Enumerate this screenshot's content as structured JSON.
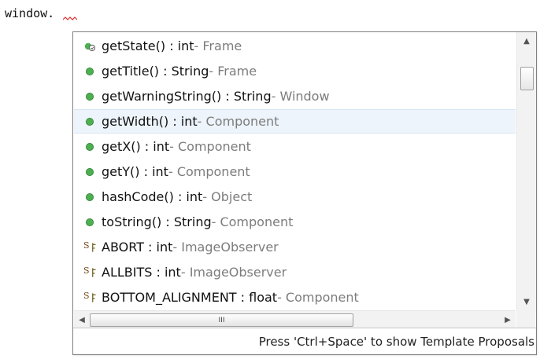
{
  "editor": {
    "text": "window."
  },
  "proposals": [
    {
      "icon": "method-protected-icon",
      "name": "getState() : int",
      "decl": " - Frame"
    },
    {
      "icon": "method-public-icon",
      "name": "getTitle() : String",
      "decl": " - Frame"
    },
    {
      "icon": "method-public-icon",
      "name": "getWarningString() : String",
      "decl": " - Window"
    },
    {
      "icon": "method-public-icon",
      "name": "getWidth() : int",
      "decl": " - Component"
    },
    {
      "icon": "method-public-icon",
      "name": "getX() : int",
      "decl": " - Component"
    },
    {
      "icon": "method-public-icon",
      "name": "getY() : int",
      "decl": " - Component"
    },
    {
      "icon": "method-public-icon",
      "name": "hashCode() : int",
      "decl": " - Object"
    },
    {
      "icon": "method-public-icon",
      "name": "toString() : String",
      "decl": " - Component"
    },
    {
      "icon": "static-final-field-icon",
      "name": "ABORT : int",
      "decl": " - ImageObserver"
    },
    {
      "icon": "static-final-field-icon",
      "name": "ALLBITS : int",
      "decl": " - ImageObserver"
    },
    {
      "icon": "static-final-field-icon",
      "name": "BOTTOM_ALIGNMENT : float",
      "decl": " - Component"
    }
  ],
  "selected_index": 3,
  "scrollbar": {
    "thumb_grip": "III",
    "up_arrow": "▲",
    "down_arrow": "▼",
    "left_arrow": "◀",
    "right_arrow": "▶"
  },
  "status": {
    "text": "Press 'Ctrl+Space' to show Template Proposals"
  },
  "colors": {
    "method_icon": "#4caf50",
    "selection": "#edf4fb",
    "declaring_type": "#7c7c7c"
  }
}
